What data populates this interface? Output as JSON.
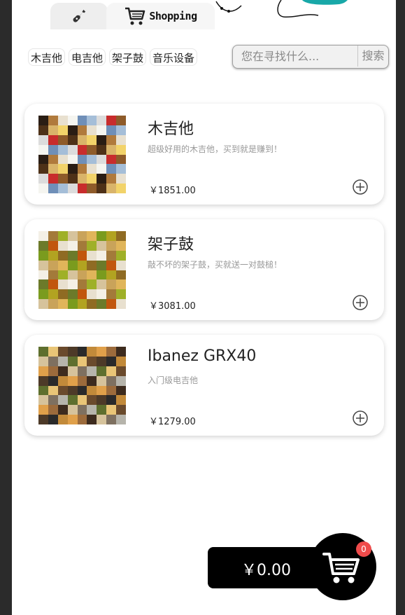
{
  "header": {
    "tabs": [
      {
        "icon": "guitar-icon",
        "label": ""
      },
      {
        "icon": "shopping-cart-icon",
        "label": "Shopping"
      }
    ]
  },
  "categories": [
    "木吉他",
    "电吉他",
    "架子鼓",
    "音乐设备"
  ],
  "search": {
    "placeholder": "您在寻找什么...",
    "button_label": "搜索"
  },
  "products": [
    {
      "name": "木吉他",
      "description": "超级好用的木吉他，买到就是赚到！",
      "price": "￥1851.00"
    },
    {
      "name": "架子鼓",
      "description": "敲不坏的架子鼓，买就送一对鼓槌！",
      "price": "￥3081.00"
    },
    {
      "name": "Ibanez GRX40",
      "description": "入门级电吉他",
      "price": "￥1279.00"
    }
  ],
  "cart": {
    "total": "￥0.00",
    "count": "0",
    "badge_color": "#ef4b4b"
  },
  "colors": {
    "accent_teal": "#1aa6a6",
    "cart_bg": "#000000"
  }
}
